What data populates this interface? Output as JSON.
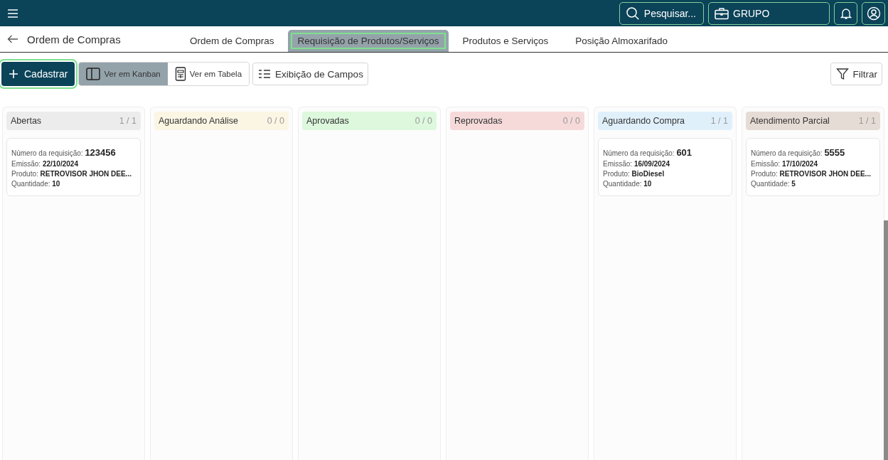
{
  "topbar": {
    "search_label": "Pesquisar...",
    "company": "GRUPO"
  },
  "page": {
    "title": "Ordem de Compras"
  },
  "tabs": [
    {
      "label": "Ordem de Compras",
      "selected": false,
      "highlighted": false
    },
    {
      "label": "Requisição de Produtos/Serviços",
      "selected": true,
      "highlighted": true
    },
    {
      "label": "Produtos e Serviços",
      "selected": false,
      "highlighted": false
    },
    {
      "label": "Posição Almoxarifado",
      "selected": false,
      "highlighted": false
    }
  ],
  "toolbar": {
    "create": {
      "label": "Cadastrar",
      "highlighted": true
    },
    "views": [
      {
        "label": "Ver em Kanban",
        "kind": "kanban",
        "selected": true
      },
      {
        "label": "Ver em Tabela",
        "kind": "table",
        "selected": false
      }
    ],
    "fields_button": "Exibição de Campos",
    "filter_button": "Filtrar"
  },
  "columns": [
    {
      "title": "Abertas",
      "count": "1 / 1",
      "color": "#ececec",
      "cards": [
        {
          "fields": [
            {
              "label": "Número da requisição:",
              "value": "123456",
              "kind": "number"
            },
            {
              "label": "Emissão:",
              "value": "22/10/2024",
              "kind": "text"
            },
            {
              "label": "Produto:",
              "value": "RETROVISOR JHON DEE...",
              "kind": "text"
            },
            {
              "label": "Quantidade:",
              "value": "10",
              "kind": "text"
            }
          ]
        }
      ]
    },
    {
      "title": "Aguardando Análise",
      "count": "0 / 0",
      "color": "#fbf6e4"
    },
    {
      "title": "Aprovadas",
      "count": "0 / 0",
      "color": "#ddf8dd"
    },
    {
      "title": "Reprovadas",
      "count": "0 / 0",
      "color": "#f6dada"
    },
    {
      "title": "Aguardando Compra",
      "count": "1 / 1",
      "color": "#e0f0fb",
      "cards": [
        {
          "fields": [
            {
              "label": "Número da requisição:",
              "value": "601",
              "kind": "number"
            },
            {
              "label": "Emissão:",
              "value": "16/09/2024",
              "kind": "text"
            },
            {
              "label": "Produto:",
              "value": "BioDiesel",
              "kind": "text"
            },
            {
              "label": "Quantidade:",
              "value": "10",
              "kind": "text"
            }
          ]
        }
      ]
    },
    {
      "title": "Atendimento Parcial",
      "count": "1 / 1",
      "color": "#e6dcd6",
      "cards": [
        {
          "fields": [
            {
              "label": "Número da requisição:",
              "value": "5555",
              "kind": "number"
            },
            {
              "label": "Emissão:",
              "value": "17/10/2024",
              "kind": "text"
            },
            {
              "label": "Produto:",
              "value": "RETROVISOR JHON DEE...",
              "kind": "text"
            },
            {
              "label": "Quantidade:",
              "value": "5",
              "kind": "text"
            }
          ]
        }
      ]
    }
  ]
}
